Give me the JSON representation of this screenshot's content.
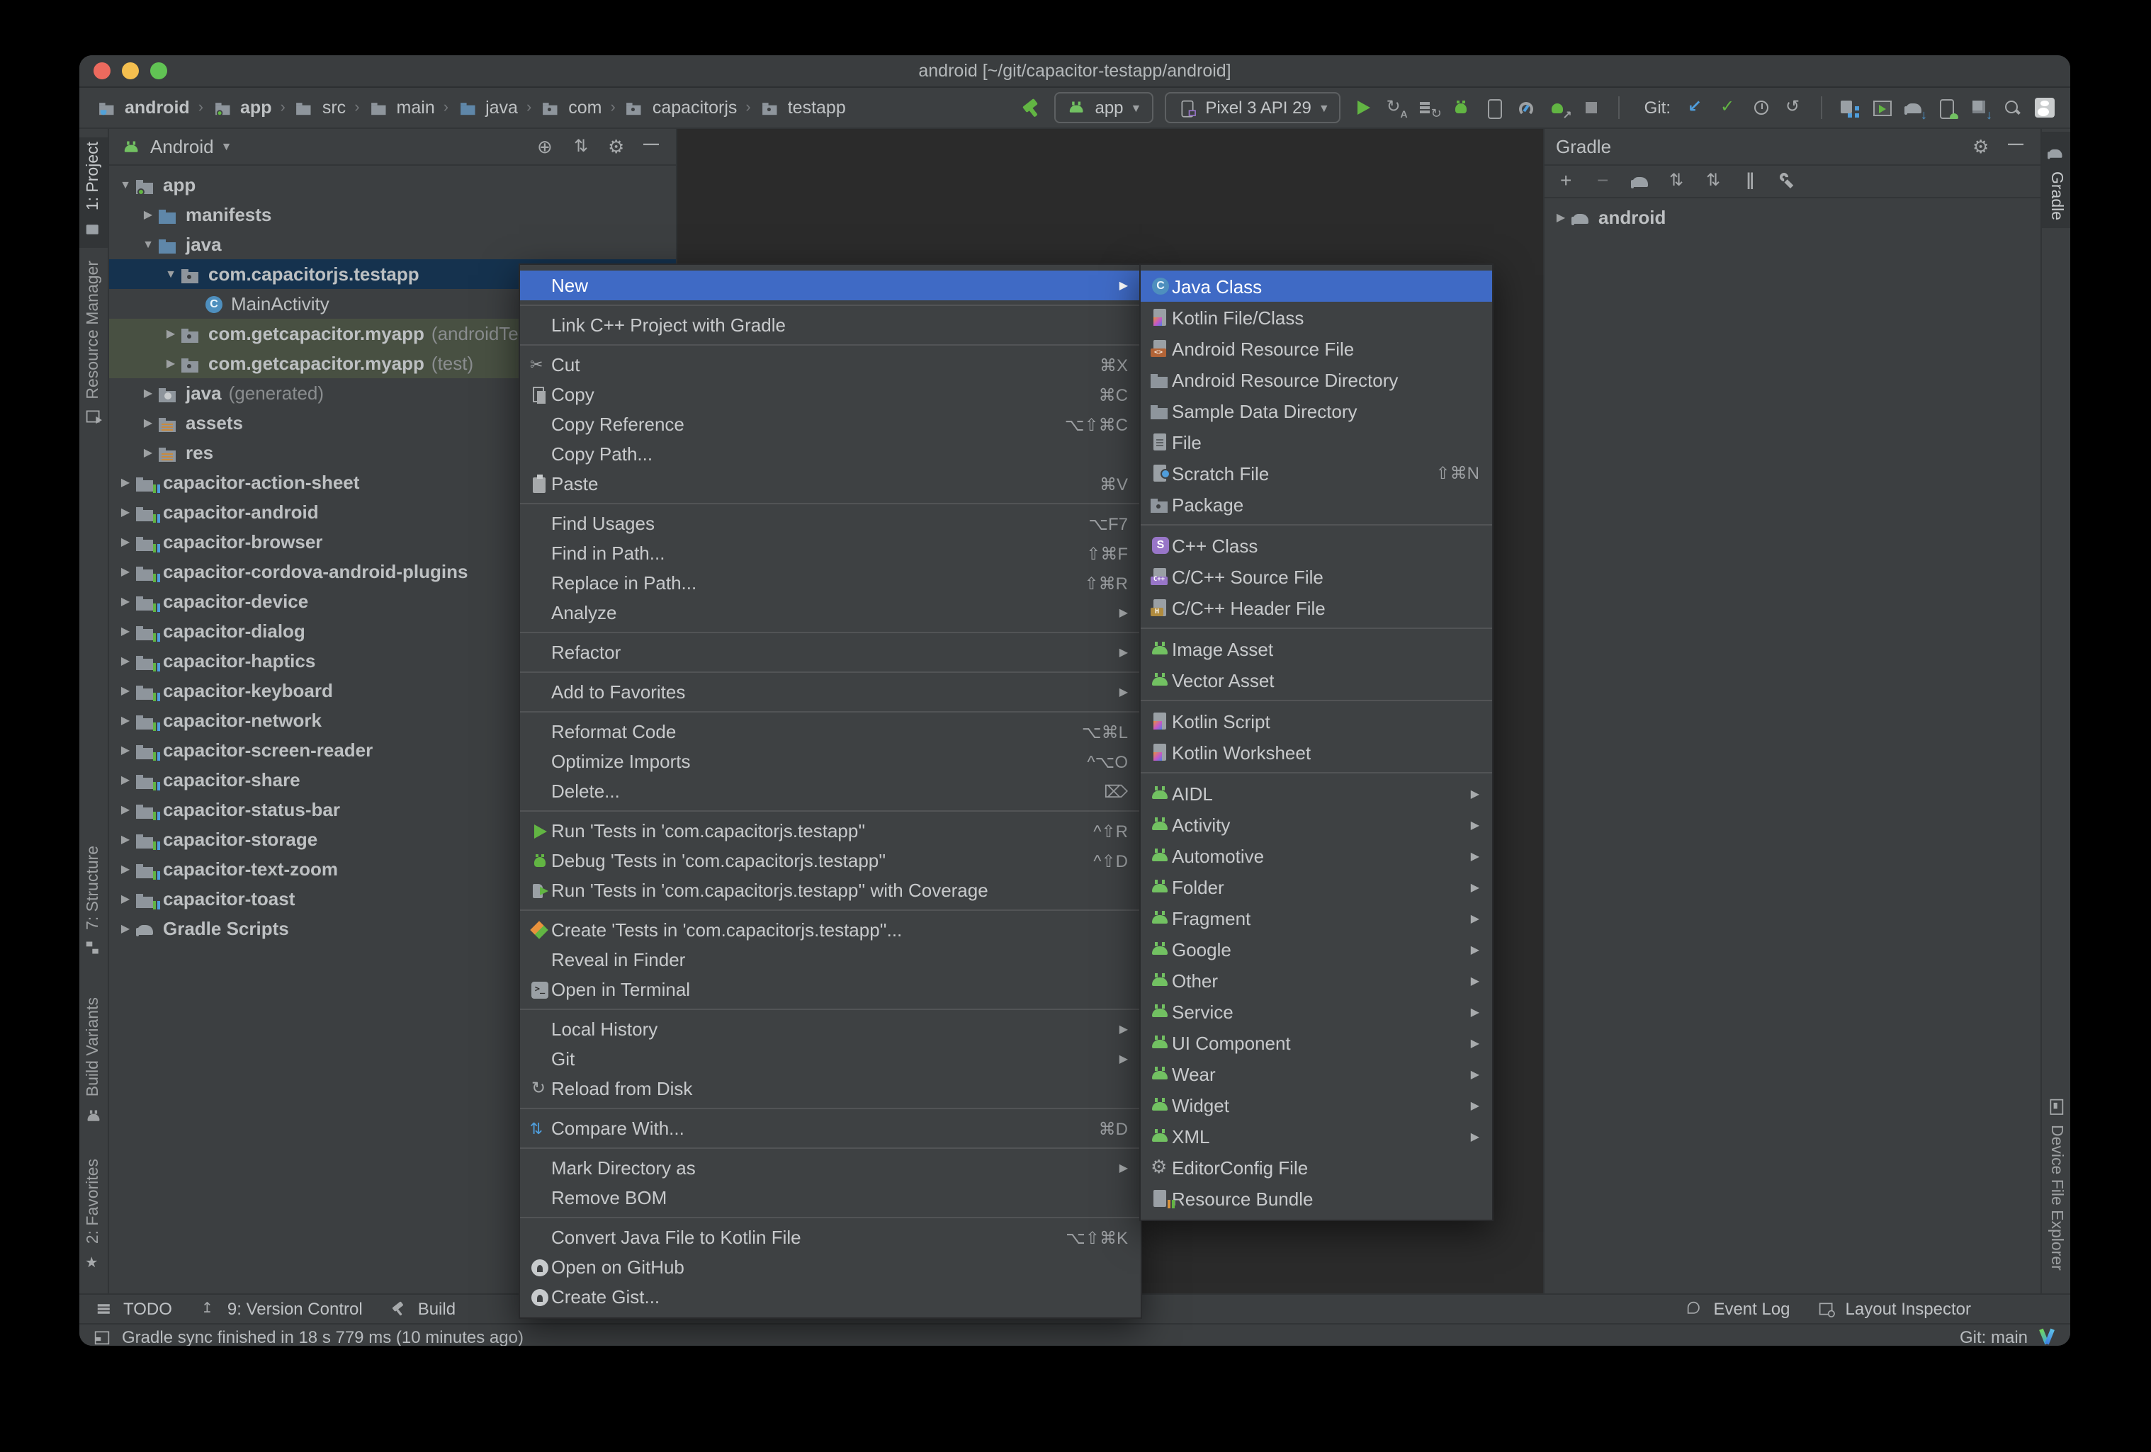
{
  "colors": {
    "chrome": "#3c3f41",
    "editor": "#2b2b2b",
    "menu_selection": "#3f6ac5",
    "tree_selection": "#15324e",
    "test_scope_row": "#485042",
    "accent_green": "#62b543",
    "accent_blue": "#4f9ddb"
  },
  "window": {
    "title": "android [~/git/capacitor-testapp/android]"
  },
  "breadcrumbs": [
    {
      "label": "android",
      "icon": "folder-java",
      "bold": true
    },
    {
      "label": "app",
      "icon": "folder-app",
      "bold": true
    },
    {
      "label": "src",
      "icon": "folder",
      "bold": false
    },
    {
      "label": "main",
      "icon": "folder",
      "bold": false
    },
    {
      "label": "java",
      "icon": "folder-src",
      "bold": false
    },
    {
      "label": "com",
      "icon": "folder-pkg",
      "bold": false
    },
    {
      "label": "capacitorjs",
      "icon": "folder-pkg",
      "bold": false
    },
    {
      "label": "testapp",
      "icon": "folder-pkg",
      "bold": false
    }
  ],
  "toolbar": {
    "run_config": "app",
    "device": "Pixel 3 API 29",
    "git_label": "Git:",
    "run_icons": [
      "run",
      "apply-changes",
      "apply-code-changes",
      "debug",
      "attach-debugger",
      "profile",
      "attach-process",
      "stop"
    ],
    "git_icons": [
      "update",
      "commit",
      "history",
      "rollback"
    ],
    "right_icons": [
      "project-structure",
      "run-window",
      "gradle-sync",
      "avd-manager",
      "sdk-manager",
      "search",
      "avatar"
    ]
  },
  "project_panel": {
    "view": "Android",
    "header_icons": [
      "locate",
      "collapse-all",
      "settings",
      "hide"
    ],
    "tree": [
      {
        "label": "app",
        "indent": 1,
        "arrow": "▼",
        "icon": "folder-app"
      },
      {
        "label": "manifests",
        "indent": 2,
        "arrow": "▶",
        "icon": "folder-src"
      },
      {
        "label": "java",
        "indent": 2,
        "arrow": "▼",
        "icon": "folder-src"
      },
      {
        "label": "com.capacitorjs.testapp",
        "indent": 3,
        "arrow": "▼",
        "icon": "folder-pkg",
        "selected": true
      },
      {
        "label": "MainActivity",
        "indent": 4,
        "arrow": "",
        "icon": "class",
        "plain": true
      },
      {
        "label": "com.getcapacitor.myapp",
        "suffix": "(androidTest)",
        "indent": 3,
        "arrow": "▶",
        "icon": "folder-pkg",
        "scope": true
      },
      {
        "label": "com.getcapacitor.myapp",
        "suffix": "(test)",
        "indent": 3,
        "arrow": "▶",
        "icon": "folder-pkg",
        "scope": true
      },
      {
        "label": "java",
        "suffix": "(generated)",
        "indent": 2,
        "arrow": "▶",
        "icon": "folder-gen"
      },
      {
        "label": "assets",
        "indent": 2,
        "arrow": "▶",
        "icon": "folder-assets"
      },
      {
        "label": "res",
        "indent": 2,
        "arrow": "▶",
        "icon": "folder-assets"
      },
      {
        "label": "capacitor-action-sheet",
        "indent": 1,
        "arrow": "▶",
        "icon": "module"
      },
      {
        "label": "capacitor-android",
        "indent": 1,
        "arrow": "▶",
        "icon": "module"
      },
      {
        "label": "capacitor-browser",
        "indent": 1,
        "arrow": "▶",
        "icon": "module"
      },
      {
        "label": "capacitor-cordova-android-plugins",
        "indent": 1,
        "arrow": "▶",
        "icon": "module"
      },
      {
        "label": "capacitor-device",
        "indent": 1,
        "arrow": "▶",
        "icon": "module"
      },
      {
        "label": "capacitor-dialog",
        "indent": 1,
        "arrow": "▶",
        "icon": "module"
      },
      {
        "label": "capacitor-haptics",
        "indent": 1,
        "arrow": "▶",
        "icon": "module"
      },
      {
        "label": "capacitor-keyboard",
        "indent": 1,
        "arrow": "▶",
        "icon": "module"
      },
      {
        "label": "capacitor-network",
        "indent": 1,
        "arrow": "▶",
        "icon": "module"
      },
      {
        "label": "capacitor-screen-reader",
        "indent": 1,
        "arrow": "▶",
        "icon": "module"
      },
      {
        "label": "capacitor-share",
        "indent": 1,
        "arrow": "▶",
        "icon": "module"
      },
      {
        "label": "capacitor-status-bar",
        "indent": 1,
        "arrow": "▶",
        "icon": "module"
      },
      {
        "label": "capacitor-storage",
        "indent": 1,
        "arrow": "▶",
        "icon": "module"
      },
      {
        "label": "capacitor-text-zoom",
        "indent": 1,
        "arrow": "▶",
        "icon": "module"
      },
      {
        "label": "capacitor-toast",
        "indent": 1,
        "arrow": "▶",
        "icon": "module"
      },
      {
        "label": "Gradle Scripts",
        "indent": 1,
        "arrow": "▶",
        "icon": "gradle"
      }
    ]
  },
  "gradle_panel": {
    "title": "Gradle",
    "header_icons": [
      "settings",
      "hide"
    ],
    "toolbar_icons": [
      "add",
      "remove",
      "gradle-refresh",
      "expand-all",
      "collapse-all",
      "toggle-offline",
      "wrench"
    ],
    "tree": [
      {
        "label": "android",
        "arrow": "▶",
        "icon": "gradle"
      }
    ]
  },
  "left_tabs": [
    {
      "label": "1: Project",
      "icon": "project",
      "active": true
    },
    {
      "label": "Resource Manager",
      "icon": "resource-manager",
      "active": false
    },
    {
      "label": "7: Structure",
      "icon": "structure",
      "active": false
    },
    {
      "label": "Build Variants",
      "icon": "build-variants",
      "active": false
    },
    {
      "label": "2: Favorites",
      "icon": "favorites",
      "active": false
    }
  ],
  "right_tabs": [
    {
      "label": "Gradle",
      "icon": "gradle",
      "active": true
    },
    {
      "label": "Device File Explorer",
      "icon": "device-explorer",
      "active": false
    }
  ],
  "bottom_bar": {
    "left": [
      {
        "label": "TODO",
        "icon": "todo"
      },
      {
        "label": "9: Version Control",
        "icon": "vcs"
      },
      {
        "label": "Build",
        "icon": "build-hammer"
      }
    ],
    "right": [
      {
        "label": "Event Log",
        "icon": "event-log"
      },
      {
        "label": "Layout Inspector",
        "icon": "layout-inspector"
      }
    ]
  },
  "status_bar": {
    "message": "Gradle sync finished in 18 s 779 ms (10 minutes ago)",
    "git_branch": "Git: main"
  },
  "context_menu": {
    "items": [
      {
        "label": "New",
        "arrow": true,
        "selected": true
      },
      {
        "sep": true
      },
      {
        "label": "Link C++ Project with Gradle"
      },
      {
        "sep": true
      },
      {
        "label": "Cut",
        "icon": "scissors",
        "shortcut": "⌘X"
      },
      {
        "label": "Copy",
        "icon": "copy",
        "shortcut": "⌘C"
      },
      {
        "label": "Copy Reference",
        "shortcut": "⌥⇧⌘C"
      },
      {
        "label": "Copy Path..."
      },
      {
        "label": "Paste",
        "icon": "clipboard",
        "shortcut": "⌘V"
      },
      {
        "sep": true
      },
      {
        "label": "Find Usages",
        "shortcut": "⌥F7"
      },
      {
        "label": "Find in Path...",
        "shortcut": "⇧⌘F"
      },
      {
        "label": "Replace in Path...",
        "shortcut": "⇧⌘R"
      },
      {
        "label": "Analyze",
        "arrow": true
      },
      {
        "sep": true
      },
      {
        "label": "Refactor",
        "arrow": true
      },
      {
        "sep": true
      },
      {
        "label": "Add to Favorites",
        "arrow": true
      },
      {
        "sep": true
      },
      {
        "label": "Reformat Code",
        "shortcut": "⌥⌘L"
      },
      {
        "label": "Optimize Imports",
        "shortcut": "^⌥O"
      },
      {
        "label": "Delete...",
        "shortcut": "⌦"
      },
      {
        "sep": true
      },
      {
        "label": "Run 'Tests in 'com.capacitorjs.testapp''",
        "icon": "run",
        "shortcut": "^⇧R"
      },
      {
        "label": "Debug 'Tests in 'com.capacitorjs.testapp''",
        "icon": "debug",
        "shortcut": "^⇧D"
      },
      {
        "label": "Run 'Tests in 'com.capacitorjs.testapp'' with Coverage",
        "icon": "coverage"
      },
      {
        "sep": true
      },
      {
        "label": "Create 'Tests in 'com.capacitorjs.testapp''...",
        "icon": "create-test"
      },
      {
        "label": "Reveal in Finder"
      },
      {
        "label": "Open in Terminal",
        "icon": "terminal"
      },
      {
        "sep": true
      },
      {
        "label": "Local History",
        "arrow": true
      },
      {
        "label": "Git",
        "arrow": true
      },
      {
        "label": "Reload from Disk",
        "icon": "reload"
      },
      {
        "sep": true
      },
      {
        "label": "Compare With...",
        "icon": "compare",
        "shortcut": "⌘D"
      },
      {
        "sep": true
      },
      {
        "label": "Mark Directory as",
        "arrow": true
      },
      {
        "label": "Remove BOM"
      },
      {
        "sep": true
      },
      {
        "label": "Convert Java File to Kotlin File",
        "shortcut": "⌥⇧⌘K"
      },
      {
        "label": "Open on GitHub",
        "icon": "github"
      },
      {
        "label": "Create Gist...",
        "icon": "github"
      }
    ]
  },
  "submenu": {
    "items": [
      {
        "label": "Java Class",
        "icon": "java-class",
        "selected": true
      },
      {
        "label": "Kotlin File/Class",
        "icon": "kotlin-file"
      },
      {
        "label": "Android Resource File",
        "icon": "res-file"
      },
      {
        "label": "Android Resource Directory",
        "icon": "folder"
      },
      {
        "label": "Sample Data Directory",
        "icon": "folder"
      },
      {
        "label": "File",
        "icon": "file"
      },
      {
        "label": "Scratch File",
        "icon": "scratch",
        "shortcut": "⇧⌘N"
      },
      {
        "label": "Package",
        "icon": "package"
      },
      {
        "sep": true
      },
      {
        "label": "C++ Class",
        "icon": "cpp-class"
      },
      {
        "label": "C/C++ Source File",
        "icon": "cpp-source"
      },
      {
        "label": "C/C++ Header File",
        "icon": "cpp-header"
      },
      {
        "sep": true
      },
      {
        "label": "Image Asset",
        "icon": "android"
      },
      {
        "label": "Vector Asset",
        "icon": "android"
      },
      {
        "sep": true
      },
      {
        "label": "Kotlin Script",
        "icon": "kotlin-script"
      },
      {
        "label": "Kotlin Worksheet",
        "icon": "kotlin-script"
      },
      {
        "sep": true
      },
      {
        "label": "AIDL",
        "icon": "android",
        "arrow": true
      },
      {
        "label": "Activity",
        "icon": "android",
        "arrow": true
      },
      {
        "label": "Automotive",
        "icon": "android",
        "arrow": true
      },
      {
        "label": "Folder",
        "icon": "android",
        "arrow": true
      },
      {
        "label": "Fragment",
        "icon": "android",
        "arrow": true
      },
      {
        "label": "Google",
        "icon": "android",
        "arrow": true
      },
      {
        "label": "Other",
        "icon": "android",
        "arrow": true
      },
      {
        "label": "Service",
        "icon": "android",
        "arrow": true
      },
      {
        "label": "UI Component",
        "icon": "android",
        "arrow": true
      },
      {
        "label": "Wear",
        "icon": "android",
        "arrow": true
      },
      {
        "label": "Widget",
        "icon": "android",
        "arrow": true
      },
      {
        "label": "XML",
        "icon": "android",
        "arrow": true
      },
      {
        "label": "EditorConfig File",
        "icon": "gear"
      },
      {
        "label": "Resource Bundle",
        "icon": "bundle"
      }
    ]
  }
}
